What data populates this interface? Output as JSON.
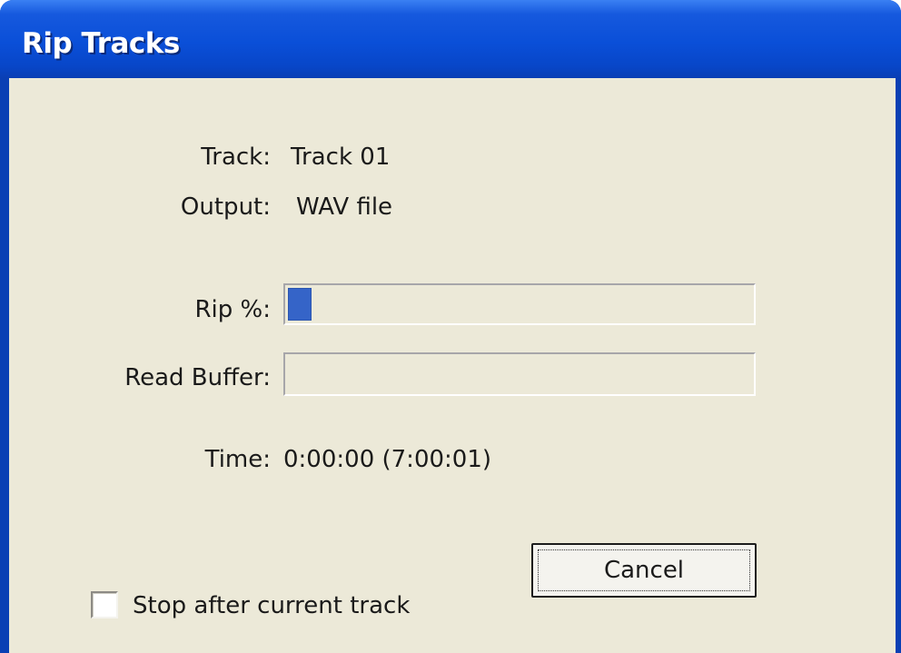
{
  "window": {
    "title": "Rip Tracks"
  },
  "fields": {
    "track_label": "Track:",
    "track_value": "Track 01",
    "output_label": "Output:",
    "output_value": "WAV file",
    "rip_label": "Rip %:",
    "read_buffer_label": "Read Buffer:",
    "time_label": "Time:",
    "time_value": "0:00:00 (7:00:01)"
  },
  "progress": {
    "rip_percent": 5,
    "read_buffer_percent": 0
  },
  "controls": {
    "cancel_label": "Cancel",
    "stop_after_label": "Stop after current track",
    "stop_after_checked": false
  },
  "colors": {
    "titlebar": "#0a4fd8",
    "client_background": "#ece9d8",
    "progress_fill": "#3564c8"
  }
}
